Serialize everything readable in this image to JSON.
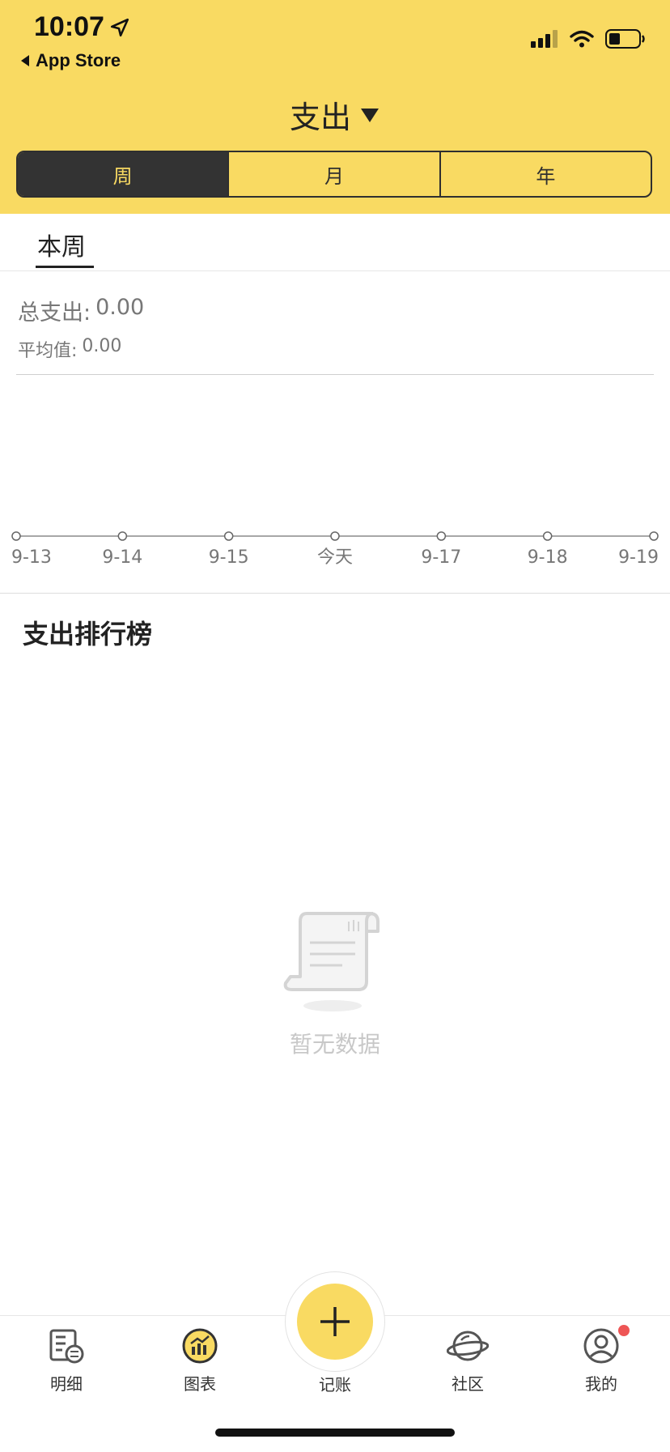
{
  "status_bar": {
    "time": "10:07",
    "back_label": "App Store"
  },
  "header": {
    "title": "支出",
    "segments": [
      "周",
      "月",
      "年"
    ],
    "active_segment": "周"
  },
  "period_tabs": {
    "current": "本周"
  },
  "summary": {
    "total_label": "总支出:",
    "total_value": "0.00",
    "average_label": "平均值:",
    "average_value": "0.00"
  },
  "chart_data": {
    "type": "line",
    "categories": [
      "9-13",
      "9-14",
      "9-15",
      "今天",
      "9-17",
      "9-18",
      "9-19"
    ],
    "values": [
      0,
      0,
      0,
      0,
      0,
      0,
      0
    ]
  },
  "ranking": {
    "title": "支出排行榜",
    "empty_text": "暂无数据"
  },
  "bottom_nav": {
    "items": [
      {
        "label": "明细",
        "icon": "detail-icon"
      },
      {
        "label": "图表",
        "icon": "chart-icon"
      },
      {
        "label": "记账",
        "icon": "plus-icon"
      },
      {
        "label": "社区",
        "icon": "planet-icon"
      },
      {
        "label": "我的",
        "icon": "user-icon"
      }
    ]
  },
  "colors": {
    "accent": "#F9DA62",
    "dark": "#333333",
    "badge": "#EE5555"
  }
}
